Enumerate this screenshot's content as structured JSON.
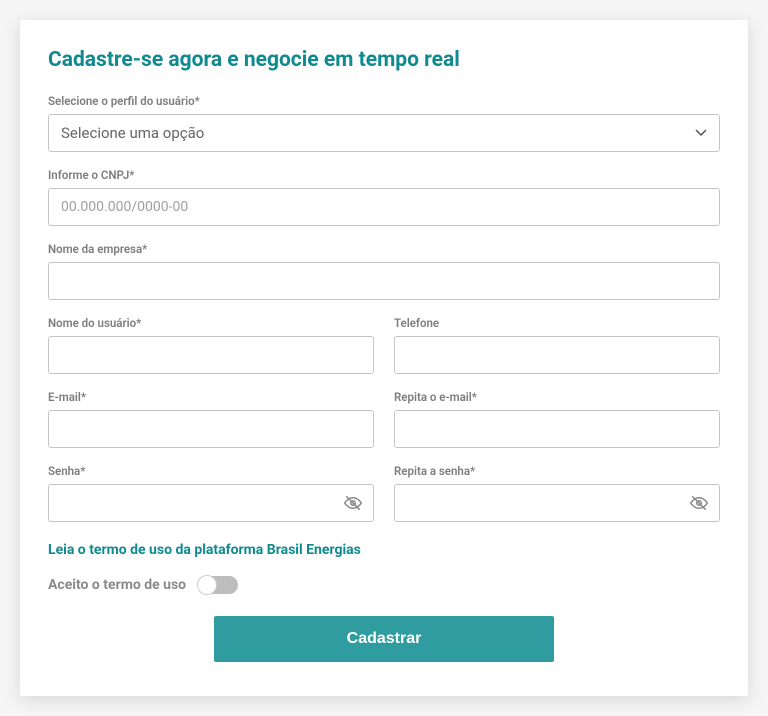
{
  "title": "Cadastre-se agora e negocie em tempo real",
  "fields": {
    "profile": {
      "label": "Selecione o perfil do usuário*",
      "placeholder": "Selecione uma opção"
    },
    "cnpj": {
      "label": "Informe o CNPJ*",
      "placeholder": "00.000.000/0000-00"
    },
    "company": {
      "label": "Nome da empresa*"
    },
    "username": {
      "label": "Nome do usuário*"
    },
    "phone": {
      "label": "Telefone"
    },
    "email": {
      "label": "E-mail*"
    },
    "email2": {
      "label": "Repita o e-mail*"
    },
    "password": {
      "label": "Senha*"
    },
    "password2": {
      "label": "Repita a senha*"
    }
  },
  "terms_link": "Leia o termo de uso da plataforma Brasil Energias",
  "accept_label": "Aceito o termo de uso",
  "submit_label": "Cadastrar"
}
